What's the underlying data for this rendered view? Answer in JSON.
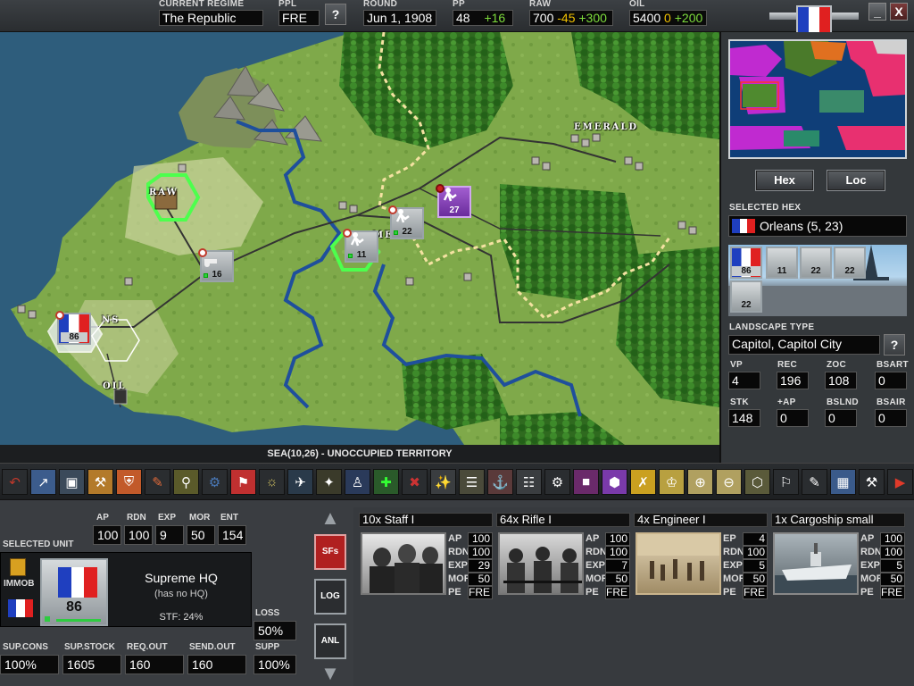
{
  "topbar": {
    "regime_label": "CURRENT REGIME",
    "regime_value": "The Republic",
    "ppl_label": "PPL",
    "ppl_value": "FRE",
    "help_label": "?",
    "round_label": "ROUND",
    "round_value": "Jun 1, 1908",
    "pp_label": "PP",
    "pp_value": "48",
    "pp_delta": "+16",
    "raw_label": "RAW",
    "raw_value": "700",
    "raw_minus": "-45",
    "raw_plus": "+300",
    "oil_label": "OIL",
    "oil_value": "5400",
    "oil_zero": "0",
    "oil_plus": "+200",
    "minimize_label": "_",
    "close_label": "X"
  },
  "map": {
    "labels": {
      "emerald": "EMERALD",
      "raw": "RAW",
      "oil": "OIL",
      "orleans_partial": "NS",
      "city_partial": "MEY"
    },
    "units": [
      {
        "id": "hq-west",
        "strength": "86",
        "kind": "hq"
      },
      {
        "id": "art-center",
        "strength": "16",
        "kind": "artillery"
      },
      {
        "id": "inf-capital",
        "strength": "11",
        "kind": "infantry"
      },
      {
        "id": "inf-front",
        "strength": "22",
        "kind": "infantry"
      },
      {
        "id": "enemy-inf",
        "strength": "27",
        "kind": "enemy-infantry"
      }
    ],
    "status": "SEA(10,26) - UNOCCUPIED TERRITORY"
  },
  "right_panel": {
    "hex_btn": "Hex",
    "loc_btn": "Loc",
    "selected_hex_title": "SELECTED HEX",
    "selected_hex_value": "Orleans (5, 23)",
    "hex_units": [
      "86",
      "11",
      "22",
      "22",
      "22"
    ],
    "landscape_title": "LANDSCAPE TYPE",
    "landscape_value": "Capitol, Capitol City",
    "landscape_help": "?",
    "stats": [
      {
        "label": "VP",
        "value": "4"
      },
      {
        "label": "REC",
        "value": "196"
      },
      {
        "label": "ZOC",
        "value": "108"
      },
      {
        "label": "BSART",
        "value": "0"
      },
      {
        "label": "STK",
        "value": "148"
      },
      {
        "label": "+AP",
        "value": "0"
      },
      {
        "label": "BSLND",
        "value": "0"
      },
      {
        "label": "BSAIR",
        "value": "0"
      }
    ]
  },
  "bottom": {
    "ap_label": "AP",
    "ap_value": "100",
    "rdn_label": "RDN",
    "rdn_value": "100",
    "exp_label": "EXP",
    "exp_value": "9",
    "mor_label": "MOR",
    "mor_value": "50",
    "ent_label": "ENT",
    "ent_value": "154",
    "selected_unit_title": "SELECTED UNIT",
    "immob_label": "IMMOB",
    "unit_name": "Supreme HQ",
    "unit_hq": "(has no HQ)",
    "unit_stf": "STF: 24%",
    "unit_strength": "86",
    "loss_label": "LOSS",
    "loss_value": "50%",
    "sup_cons_label": "SUP.CONS",
    "sup_cons_value": "100%",
    "sup_stock_label": "SUP.STOCK",
    "sup_stock_value": "1605",
    "req_out_label": "REQ.OUT",
    "req_out_value": "160",
    "send_out_label": "SEND.OUT",
    "send_out_value": "160",
    "supp_label": "SUPP",
    "supp_value": "100%",
    "tabs": [
      "SFs",
      "LOG",
      "ANL"
    ],
    "subformations": [
      {
        "title": "10x Staff I",
        "stats": [
          [
            "AP",
            "100"
          ],
          [
            "RDN",
            "100"
          ],
          [
            "EXP",
            "29"
          ],
          [
            "MOR",
            "50"
          ],
          [
            "PE",
            "FRE"
          ]
        ]
      },
      {
        "title": "64x Rifle I",
        "stats": [
          [
            "AP",
            "100"
          ],
          [
            "RDN",
            "100"
          ],
          [
            "EXP",
            "7"
          ],
          [
            "MOR",
            "50"
          ],
          [
            "PE",
            "FRE"
          ]
        ]
      },
      {
        "title": "4x Engineer I",
        "stats": [
          [
            "EP",
            "4"
          ],
          [
            "RDN",
            "100"
          ],
          [
            "EXP",
            "5"
          ],
          [
            "MOR",
            "50"
          ],
          [
            "PE",
            "FRE"
          ]
        ]
      },
      {
        "title": "1x Cargoship small",
        "stats": [
          [
            "AP",
            "100"
          ],
          [
            "RDN",
            "100"
          ],
          [
            "EXP",
            "5"
          ],
          [
            "MOR",
            "50"
          ],
          [
            "PE",
            "FRE"
          ]
        ]
      }
    ]
  },
  "colors": {
    "flag_blue": "#1f3fbf",
    "flag_white": "#ffffff",
    "flag_red": "#e02020",
    "positive": "#7ddc3c",
    "warning": "#f2c200"
  }
}
